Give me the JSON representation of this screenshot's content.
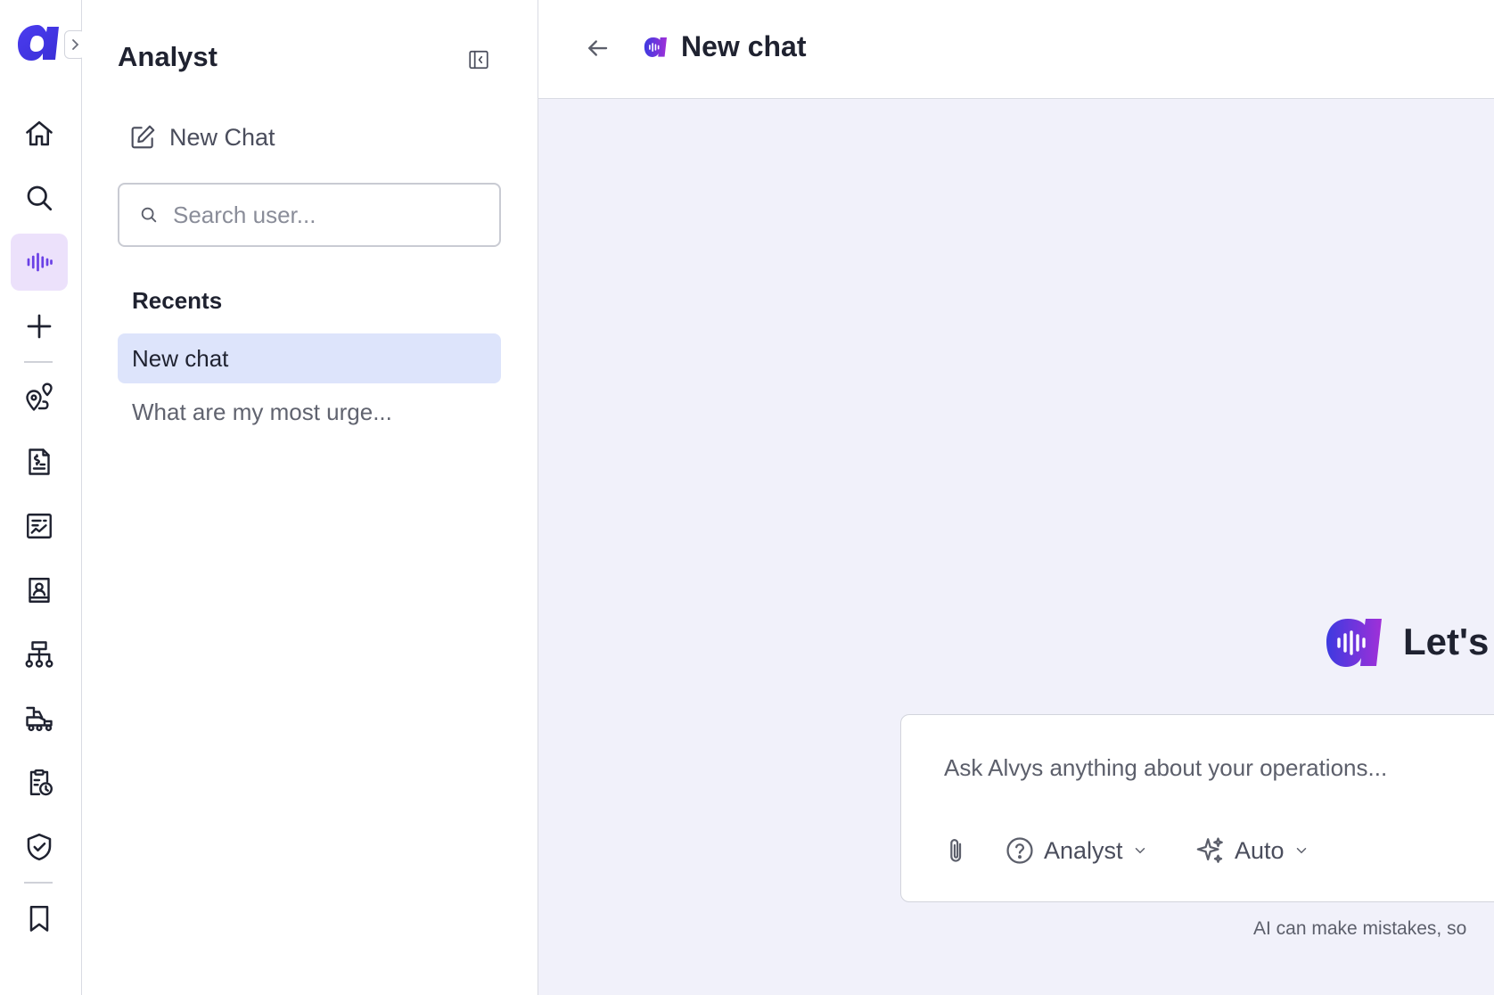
{
  "colors": {
    "brand_blue": "#3d3ae0",
    "brand_purple": "#8b34e0",
    "active_rail_bg": "#ece1fb",
    "active_recent_bg": "#dde4fb",
    "main_bg": "#f1f1fa"
  },
  "rail": {
    "logo_icon": "alvys-a-logo",
    "toggle_icon": "chevron-right-icon",
    "items": [
      {
        "icon": "home-icon",
        "active": false
      },
      {
        "icon": "search-icon",
        "active": false
      },
      {
        "icon": "analyst-waveform-icon",
        "active": true
      },
      {
        "icon": "plus-icon",
        "active": false
      },
      {
        "icon": "route-pin-icon",
        "active": false
      },
      {
        "icon": "invoice-dollar-icon",
        "active": false
      },
      {
        "icon": "report-chart-icon",
        "active": false
      },
      {
        "icon": "contact-book-icon",
        "active": false
      },
      {
        "icon": "hierarchy-icon",
        "active": false
      },
      {
        "icon": "truck-trailer-icon",
        "active": false
      },
      {
        "icon": "clipboard-clock-icon",
        "active": false
      },
      {
        "icon": "shield-check-icon",
        "active": false
      },
      {
        "icon": "bookmark-icon",
        "active": false
      }
    ]
  },
  "panel": {
    "title": "Analyst",
    "collapse_icon": "collapse-panel-icon",
    "new_chat_label": "New Chat",
    "new_chat_icon": "edit-icon",
    "search_placeholder": "Search user...",
    "search_icon": "search-icon",
    "recents_label": "Recents",
    "recents": [
      {
        "label": "New chat",
        "active": true
      },
      {
        "label": "What are my most urge...",
        "active": false
      }
    ]
  },
  "main": {
    "title": "New chat",
    "back_icon": "arrow-left-icon",
    "hero_text": "Let's",
    "composer": {
      "placeholder": "Ask Alvys anything about your operations...",
      "attach_icon": "paperclip-icon",
      "mode_label": "Analyst",
      "mode_icon": "help-circle-icon",
      "model_label": "Auto",
      "model_icon": "sparkles-icon"
    },
    "disclaimer": "AI can make mistakes, so"
  }
}
